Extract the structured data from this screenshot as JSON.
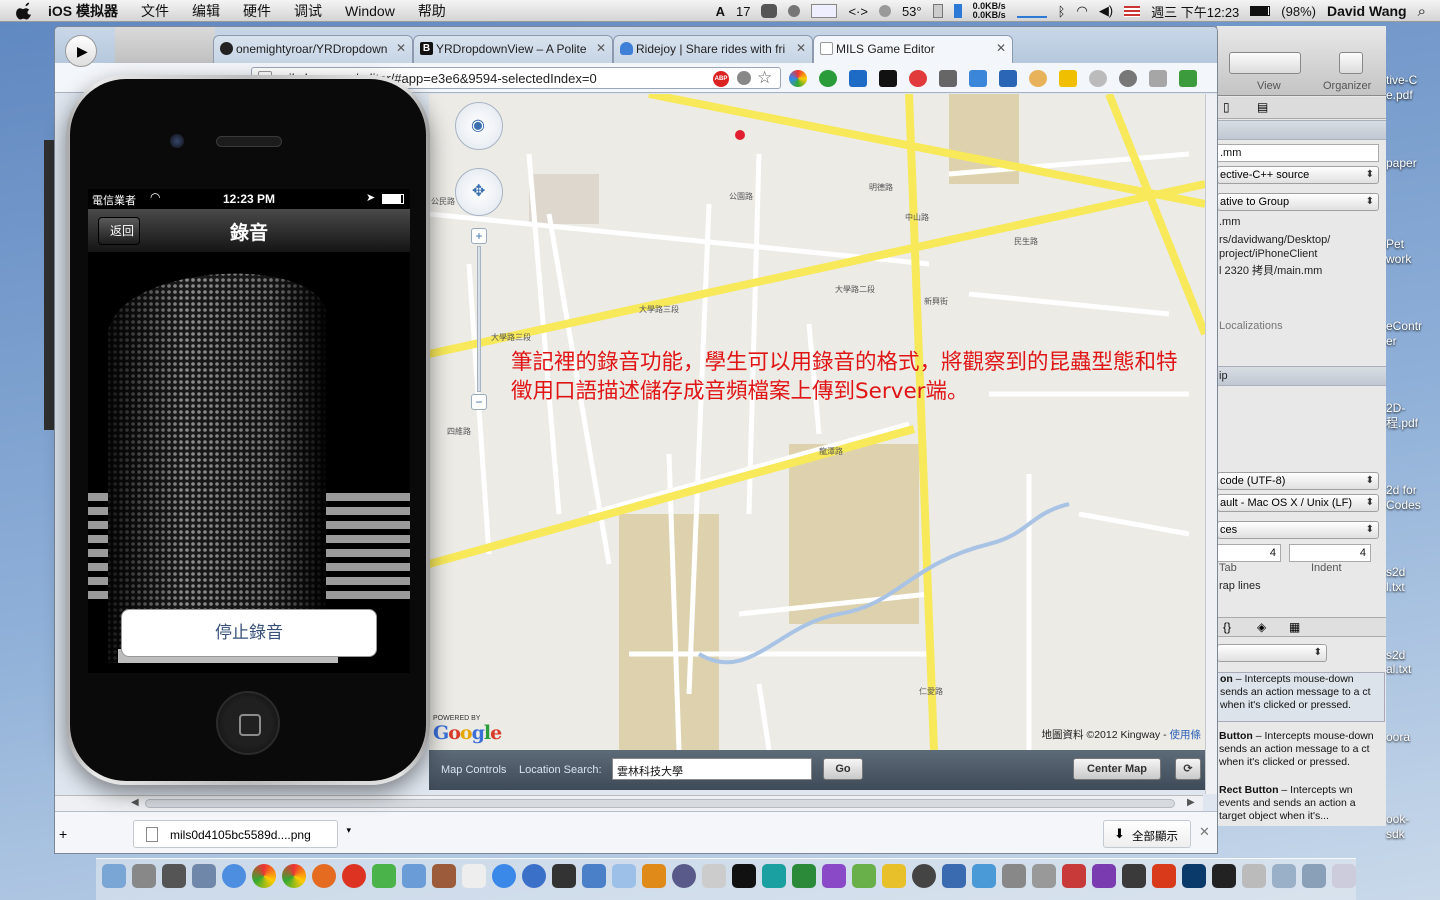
{
  "menubar": {
    "app_name": "iOS 模拟器",
    "items": [
      "文件",
      "编辑",
      "硬件",
      "调试",
      "Window",
      "帮助"
    ],
    "status": {
      "adobe_count": "17",
      "temperature": "53°",
      "net_up": "0.0KB/s",
      "net_down": "0.0KB/s",
      "datetime": "週三 下午12:23",
      "battery": "(98%)",
      "user": "David Wang"
    }
  },
  "chrome": {
    "tabs": [
      {
        "label": "onemightyroar/YRDropdown",
        "favicon": "github-icon"
      },
      {
        "label": "YRDropdownView – A Polite",
        "favicon": "b-icon"
      },
      {
        "label": "Ridejoy | Share rides with fri",
        "favicon": "ridejoy-icon"
      },
      {
        "label": "MILS Game Editor",
        "favicon": "page-icon",
        "active": true
      }
    ],
    "url": "mils.h... .com/editor/#app=e3e6&9594-selectedIndex=0",
    "downloads": {
      "file": "mils0d4105bc5589d....png",
      "show_all": "全部顯示"
    }
  },
  "map": {
    "overlay_text": "筆記裡的錄音功能，學生可以用錄音的格式，將觀察到的昆蟲型態和特徵用口語描述儲存成音頻檔案上傳到Server端。",
    "credit": "地圖資料 ©2012 Kingway -",
    "terms_link": "使用條",
    "powered_by": "POWERED BY",
    "google": "Google",
    "streets": [
      "大學路三段",
      "大學路二段",
      "大學路三段",
      "中山路",
      "明德路",
      "公園路",
      "龍潭路",
      "新興街",
      "仁愛路",
      "四維路",
      "公民路",
      "民生路"
    ]
  },
  "map_controls": {
    "label": "Map Controls",
    "search_label": "Location Search:",
    "search_value": "雲林科技大學",
    "go": "Go",
    "center_map": "Center Map"
  },
  "iphone": {
    "carrier": "電信業者",
    "time": "12:23 PM",
    "nav_title": "錄音",
    "back": "返回",
    "stop_button": "停止錄音"
  },
  "xcode": {
    "toolbar": {
      "view": "View",
      "organizer": "Organizer"
    },
    "fields": {
      "name": ".mm",
      "file_type": "ective-C++ source",
      "location": "ative to Group",
      "filename": ".mm",
      "path1": "rs/davidwang/Desktop/",
      "path2": "project/iPhoneClient",
      "path3": "l 2320 拷貝/main.mm",
      "localizations": "Localizations",
      "section": "ip",
      "encoding": "code (UTF-8)",
      "line_endings": "ault - Mac OS X / Unix (LF)",
      "indent_using": "ces",
      "tab_width": "4",
      "indent_width": "4",
      "tab_label": "Tab",
      "indent_label": "Indent",
      "wrap": "rap lines",
      "braces": "{}"
    },
    "library": [
      {
        "title": "on",
        "text": "– Intercepts mouse-down sends an action message to a ct when it's clicked or pressed."
      },
      {
        "title": "Button",
        "text": "– Intercepts mouse-down sends an action message to a ct when it's clicked or pressed."
      },
      {
        "title": "Rect Button",
        "text": "– Intercepts wn events and sends an action a target object when it's..."
      }
    ]
  },
  "desktop_labels": [
    "tive-C",
    "e.pdf",
    "paper",
    "Pet",
    "work",
    "eContr",
    "er",
    "2D-",
    "程.pdf",
    "2d for",
    "Codes",
    "s2d",
    "l.txt",
    "s2d",
    "al.txt",
    "oora",
    "ook-",
    "sdk"
  ],
  "colors": {
    "overlay_text": "#e01515",
    "road_major": "#f7e95a",
    "map_bg": "#ecebe6",
    "campus": "#ddd2ad"
  }
}
